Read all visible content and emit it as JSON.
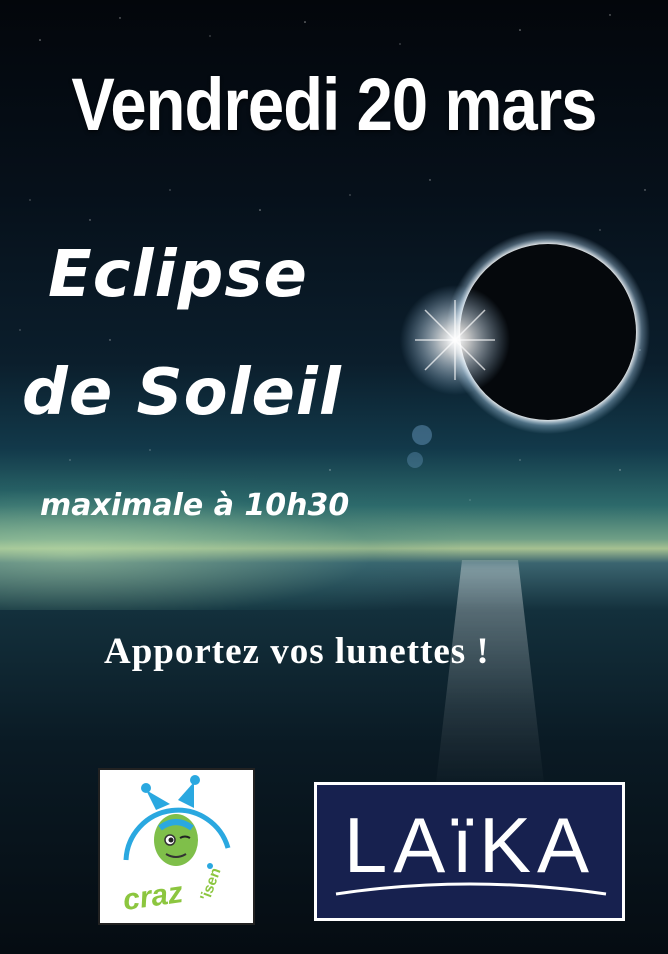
{
  "poster": {
    "date": "Vendredi 20 mars",
    "event_line1": "Eclipse",
    "event_line2": "de Soleil",
    "subtitle": "maximale à 10h30",
    "call_to_action": "Apportez vos lunettes !"
  },
  "logos": {
    "left": {
      "text_main": "craz",
      "text_suffix": "'isen",
      "icon": "jester-mascot-icon",
      "color": "#8cc63f",
      "accent": "#2aa8e0"
    },
    "right": {
      "text": "LAïKA",
      "background": "#17214f"
    }
  },
  "colors": {
    "sky_top": "#03060b",
    "horizon": "#a6c191",
    "text": "#ffffff"
  }
}
